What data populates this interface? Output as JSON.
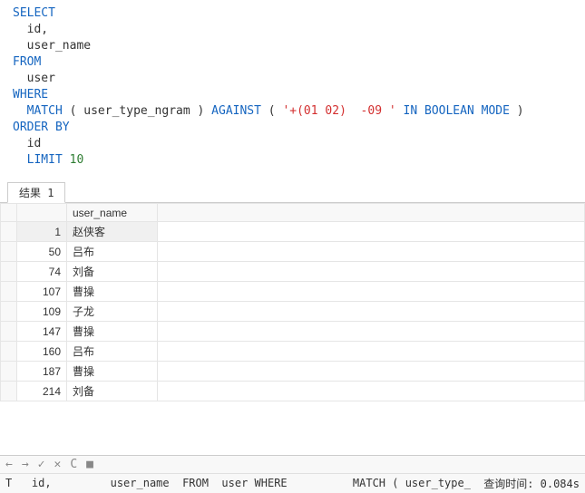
{
  "sql": {
    "l1a": "SELECT",
    "l2a": "  id,",
    "l3a": "  user_name",
    "l4a": "FROM",
    "l5a": "  user",
    "l6a": "WHERE",
    "l7a": "  MATCH",
    "l7b": " ( user_type_ngram ) ",
    "l7c": "AGAINST",
    "l7d": " ( ",
    "l7e": "'+(01 02)  -09 '",
    "l7f": " IN",
    "l7g": " BOOLEAN",
    "l7h": " MODE",
    "l7i": " )",
    "l8a": "ORDER BY",
    "l9a": "  id",
    "l10a": "  LIMIT",
    "l10b": " 10"
  },
  "tab": {
    "label": "结果 1"
  },
  "grid": {
    "col_name": "user_name",
    "rows": {
      "r0": {
        "id": "1",
        "name": "赵侠客"
      },
      "r1": {
        "id": "50",
        "name": "吕布"
      },
      "r2": {
        "id": "74",
        "name": "刘备"
      },
      "r3": {
        "id": "107",
        "name": "曹操"
      },
      "r4": {
        "id": "109",
        "name": "子龙"
      },
      "r5": {
        "id": "147",
        "name": "曹操"
      },
      "r6": {
        "id": "160",
        "name": "吕布"
      },
      "r7": {
        "id": "187",
        "name": "曹操"
      },
      "r8": {
        "id": "214",
        "name": "刘备"
      }
    }
  },
  "status": {
    "icons": {
      "left": "←",
      "right": "→",
      "check": "✓",
      "x": "✕",
      "reload": "C",
      "stop": "■"
    },
    "query": "T   id,         user_name  FROM  user WHERE          MATCH ( user_type_",
    "time": "查询时间: 0.084s"
  }
}
